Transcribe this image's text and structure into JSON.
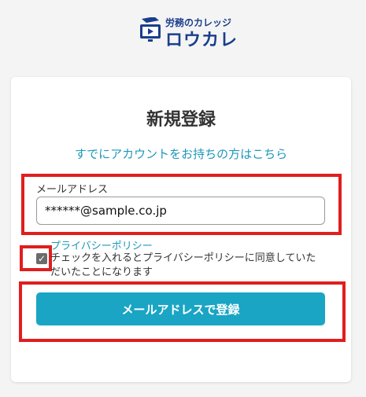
{
  "logo": {
    "subtitle": "労務のカレッジ",
    "name": "ロウカレ",
    "icon": "monitor-play-icon"
  },
  "form": {
    "title": "新規登録",
    "login_link": "すでにアカウントをお持ちの方はこちら",
    "email_label": "メールアドレス",
    "email_value": "******@sample.co.jp",
    "privacy_link": "プライバシーポリシー",
    "consent_text": "チェックを入れるとプライバシーポリシーに同意していただいたことになります",
    "consent_checked": true,
    "submit_label": "メールアドレスで登録"
  },
  "colors": {
    "accent": "#1aa5c4",
    "link": "#1e98b8",
    "brand": "#1a3e8c",
    "highlight": "#e01e1e"
  }
}
